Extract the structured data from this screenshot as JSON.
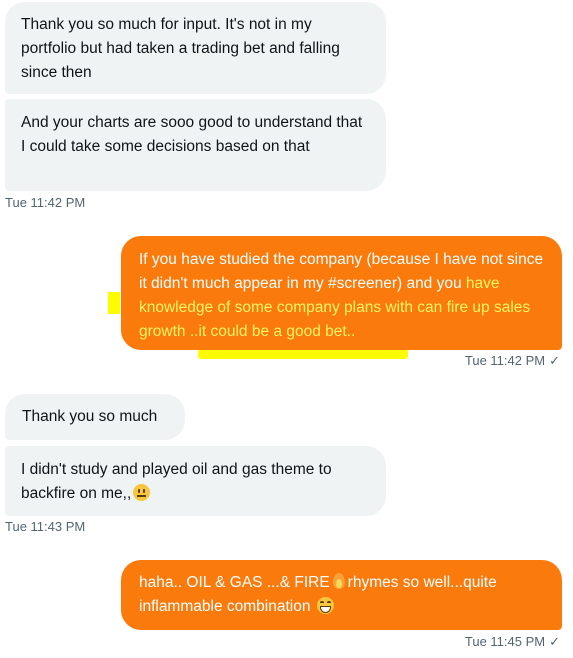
{
  "messages": [
    {
      "text": "Thank you so much for input. It's not in my portfolio but had taken a trading bet and falling since then"
    },
    {
      "text": "And your charts are sooo good to understand that I could take some decisions based on that"
    },
    {
      "timestamp": "Tue 11:42 PM"
    },
    {
      "text_plain": "If you have studied the company (because I have not since it didn't much appear in my #screener) and you ",
      "text_highlight": "have knowledge of some company plans with can fire up sales growth ..it could be a good bet..",
      "timestamp": "Tue 11:42 PM"
    },
    {
      "text": "Thank you so much"
    },
    {
      "text": "I didn't study and played oil and gas theme to backfire on me,,",
      "emoji": "neutral-face-icon"
    },
    {
      "timestamp": "Tue 11:43 PM"
    },
    {
      "text_before": "haha.. OIL & GAS ...& FIRE",
      "emoji_mid": "fire-icon",
      "text_after": "rhymes so well...quite inflammable combination",
      "emoji_end": "grinning-face-icon",
      "timestamp": "Tue 11:45 PM"
    }
  ],
  "read_mark": "✓",
  "colors": {
    "incoming_bg": "#eff3f4",
    "outgoing_bg": "#fb7a0c",
    "highlight_text": "#fff566",
    "marker": "#fffc00",
    "timestamp": "#536471"
  }
}
